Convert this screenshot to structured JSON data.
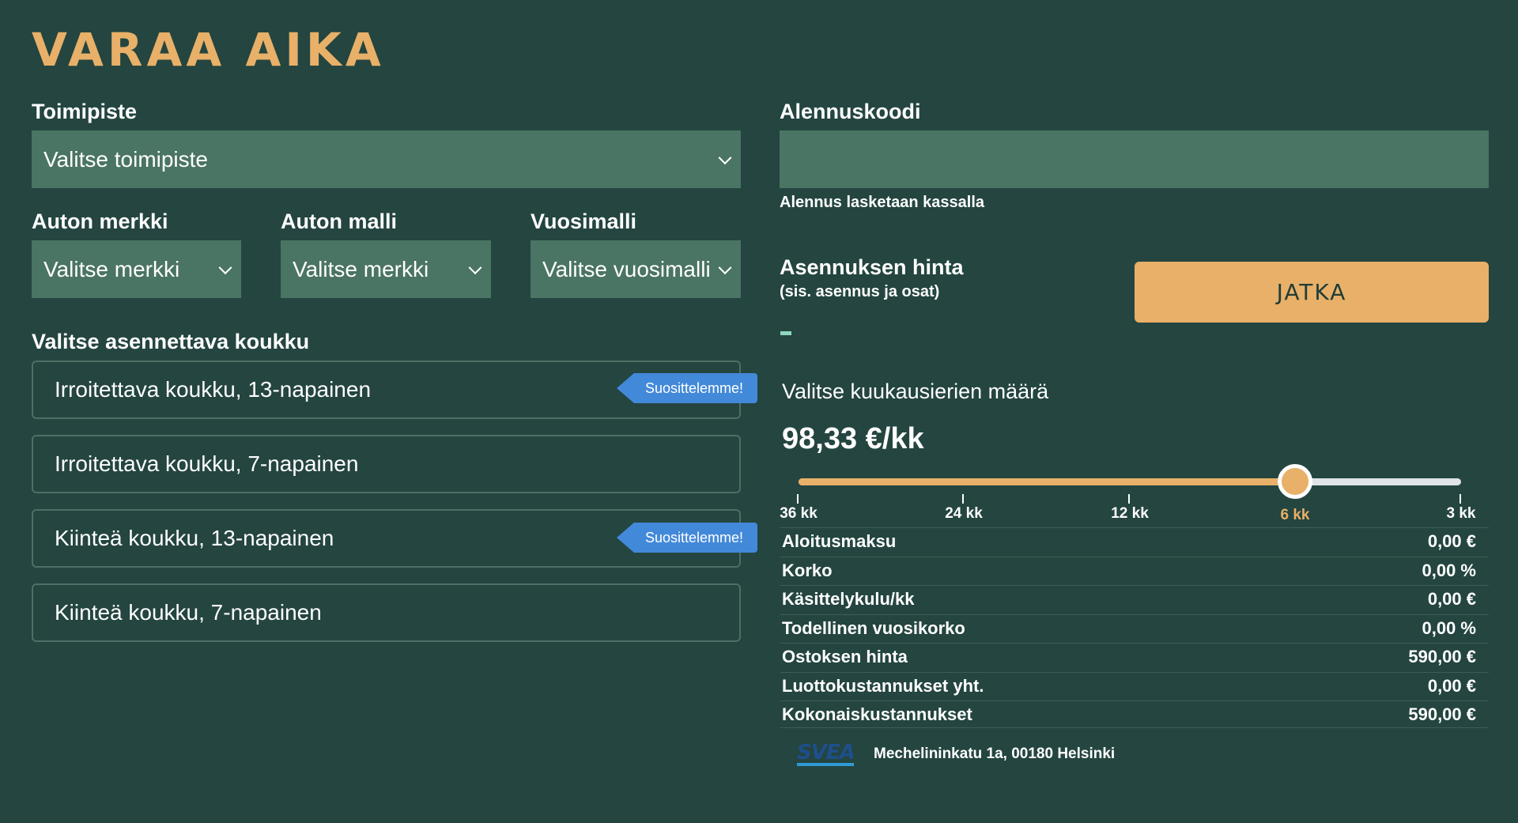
{
  "page": {
    "title": "VARAA AIKA"
  },
  "colors": {
    "background": "#244540",
    "accent": "#e8b068",
    "field": "#4a7463",
    "badge": "#4389d9",
    "track": "#dfe3ea"
  },
  "toimipiste": {
    "label": "Toimipiste",
    "value": "Valitse toimipiste"
  },
  "merkki": {
    "label": "Auton merkki",
    "value": "Valitse merkki"
  },
  "malli": {
    "label": "Auton malli",
    "value": "Valitse merkki"
  },
  "vuosimalli": {
    "label": "Vuosimalli",
    "value": "Valitse vuosimalli"
  },
  "koukku": {
    "label": "Valitse asennettava koukku",
    "options": [
      {
        "label": "Irroitettava koukku, 13-napainen",
        "badge": "Suosittelemme!"
      },
      {
        "label": "Irroitettava koukku, 7-napainen"
      },
      {
        "label": "Kiinteä koukku, 13-napainen",
        "badge": "Suosittelemme!"
      },
      {
        "label": "Kiinteä koukku, 7-napainen"
      }
    ]
  },
  "alennus": {
    "label": "Alennuskoodi",
    "value": "",
    "note": "Alennus lasketaan kassalla"
  },
  "asennus": {
    "label": "Asennuksen hinta",
    "sub": "(sis. asennus ja osat)"
  },
  "jatka_label": "JATKA",
  "installments": {
    "label": "Valitse kuukausierien määrä",
    "price": "98,33 €/kk",
    "ticks": [
      "36 kk",
      "24 kk",
      "12 kk",
      "6 kk",
      "3 kk"
    ],
    "selected": "6 kk",
    "selected_index": 3
  },
  "summary": [
    {
      "label": "Aloitusmaksu",
      "value": "0,00 €"
    },
    {
      "label": "Korko",
      "value": "0,00 %"
    },
    {
      "label": "Käsittelykulu/kk",
      "value": "0,00 €"
    },
    {
      "label": "Todellinen vuosikorko",
      "value": "0,00 %"
    },
    {
      "label": "Ostoksen hinta",
      "value": "590,00 €"
    },
    {
      "label": "Luottokustannukset yht.",
      "value": "0,00 €"
    },
    {
      "label": "Kokonaiskustannukset",
      "value": "590,00 €"
    }
  ],
  "footer": {
    "logo_text": "SVEA",
    "address": "Mechelininkatu 1a, 00180 Helsinki"
  }
}
